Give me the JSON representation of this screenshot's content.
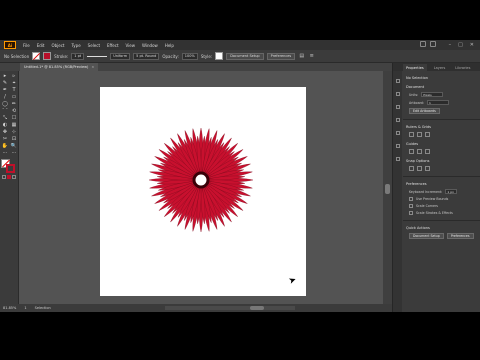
{
  "app": {
    "logo": "Ai",
    "menu": [
      "File",
      "Edit",
      "Object",
      "Type",
      "Select",
      "Effect",
      "View",
      "Window",
      "Help"
    ],
    "window_controls": [
      "–",
      "□",
      "✕"
    ]
  },
  "control_bar": {
    "selection_label": "No Selection",
    "stroke_label": "Stroke:",
    "stroke_weight": "1 pt",
    "stroke_style": "Uniform",
    "brush": "5 pt. Round",
    "opacity_label": "Opacity:",
    "opacity_value": "100%",
    "style_label": "Style:",
    "doc_setup_button": "Document Setup",
    "preferences_button": "Preferences"
  },
  "document": {
    "tab_title": "Untitled-1* @ 81.85% (RGB/Preview)",
    "close_glyph": "×"
  },
  "artwork": {
    "petal_count": 40,
    "petal_color": "#c8102e",
    "petal_edge_color": "#7a0a1c",
    "center_ring_color": "#3a0008"
  },
  "status_bar": {
    "zoom": "81.85%",
    "page": "1",
    "tool": "Selection"
  },
  "properties": {
    "tabs": [
      "Properties",
      "Layers",
      "Libraries"
    ],
    "no_selection": "No Selection",
    "document_section": "Document",
    "units_label": "Units:",
    "units_value": "Pixels",
    "artboard_label": "Artboard:",
    "artboard_value": "1",
    "edit_artboards_button": "Edit Artboards",
    "rulers_grids_section": "Rulers & Grids",
    "guides_section": "Guides",
    "snap_options_section": "Snap Options",
    "preferences_section": "Preferences",
    "keyboard_increment_label": "Keyboard Increment:",
    "keyboard_increment_value": "1 px",
    "use_preview_bounds": "Use Preview Bounds",
    "scale_corners": "Scale Corners",
    "scale_strokes": "Scale Strokes & Effects",
    "quick_actions_section": "Quick Actions",
    "document_setup_button": "Document Setup",
    "preferences_button": "Preferences"
  },
  "tools": [
    "▸",
    "▹",
    "✎",
    "⌖",
    "✒",
    "T",
    "/",
    "▭",
    "◯",
    "✏",
    "⌒",
    "⟲",
    "⤡",
    "☐",
    "◐",
    "▦",
    "✥",
    "⊹",
    "✂",
    "⊡",
    "✋",
    "🔍",
    "⋯",
    "⋯"
  ]
}
